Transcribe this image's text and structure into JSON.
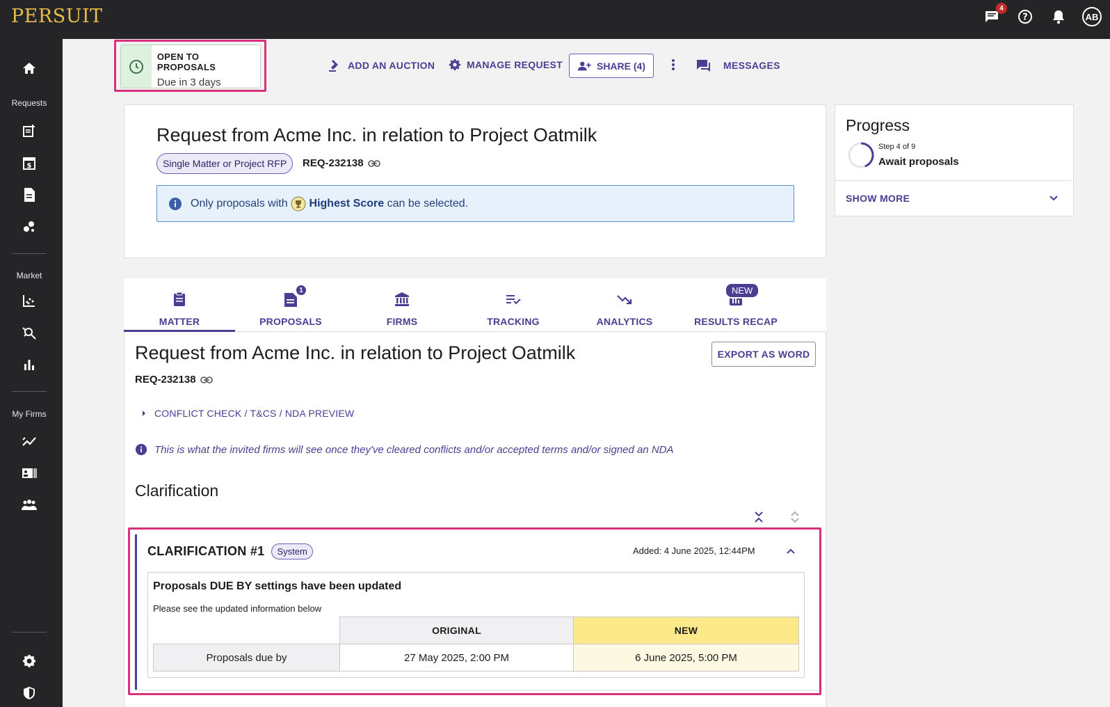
{
  "app": {
    "logo": "PERSUIT"
  },
  "topbar": {
    "messages_badge": "4",
    "avatar_initials": "AB"
  },
  "sidebar": {
    "sections": {
      "requests": "Requests",
      "market": "Market",
      "my_firms": "My Firms"
    }
  },
  "status": {
    "title": "OPEN TO PROPOSALS",
    "due": "Due in 3 days"
  },
  "actions": {
    "add_auction": "ADD AN AUCTION",
    "manage_request": "MANAGE REQUEST",
    "share": "SHARE (4)",
    "messages": "MESSAGES"
  },
  "request": {
    "title": "Request from Acme Inc. in relation to Project Oatmilk",
    "type_chip": "Single Matter or Project RFP",
    "id": "REQ-232138",
    "info_prefix": "Only proposals with",
    "info_bold": "Highest Score",
    "info_suffix": "can be selected."
  },
  "progress": {
    "title": "Progress",
    "step": "Step 4 of 9",
    "step_name": "Await proposals",
    "step_fraction": 0.444,
    "show_more": "SHOW MORE"
  },
  "tabs": [
    {
      "label": "MATTER"
    },
    {
      "label": "PROPOSALS",
      "badge": "1"
    },
    {
      "label": "FIRMS"
    },
    {
      "label": "TRACKING"
    },
    {
      "label": "ANALYTICS"
    },
    {
      "label": "RESULTS RECAP",
      "badge": "NEW"
    }
  ],
  "matter": {
    "title": "Request from Acme Inc. in relation to Project Oatmilk",
    "id": "REQ-232138",
    "export": "EXPORT AS WORD",
    "conflict_link": "CONFLICT CHECK / T&CS / NDA PREVIEW",
    "note": "This is what the invited firms will see once they've cleared conflicts and/or accepted terms and/or signed an NDA",
    "clarification_heading": "Clarification"
  },
  "clarification": {
    "title": "CLARIFICATION #1",
    "chip": "System",
    "added": "Added: 4 June 2025, 12:44PM",
    "inner_title": "Proposals DUE BY settings have been updated",
    "inner_sub": "Please see the updated information below",
    "col_original": "ORIGINAL",
    "col_new": "NEW",
    "row_label": "Proposals due by",
    "original_value": "27 May 2025, 2:00 PM",
    "new_value": "6 June 2025, 5:00 PM"
  },
  "colors": {
    "accent": "#4a3e93",
    "highlight": "#d8307a",
    "topbar": "#252527"
  }
}
